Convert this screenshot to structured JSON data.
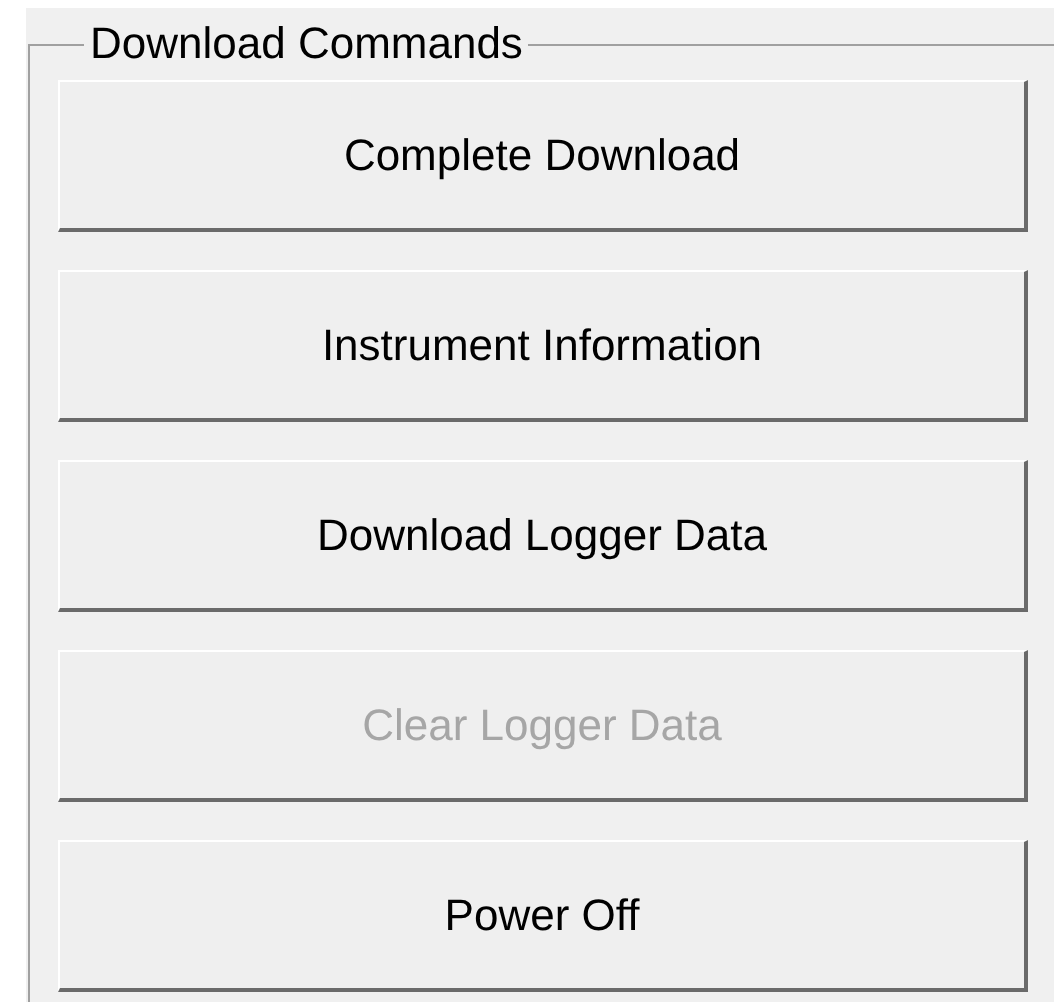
{
  "group": {
    "title": "Download Commands"
  },
  "buttons": [
    {
      "label": "Complete Download",
      "disabled": false
    },
    {
      "label": "Instrument Information",
      "disabled": false
    },
    {
      "label": "Download Logger Data",
      "disabled": false
    },
    {
      "label": "Clear Logger Data",
      "disabled": true
    },
    {
      "label": "Power Off",
      "disabled": false
    }
  ]
}
